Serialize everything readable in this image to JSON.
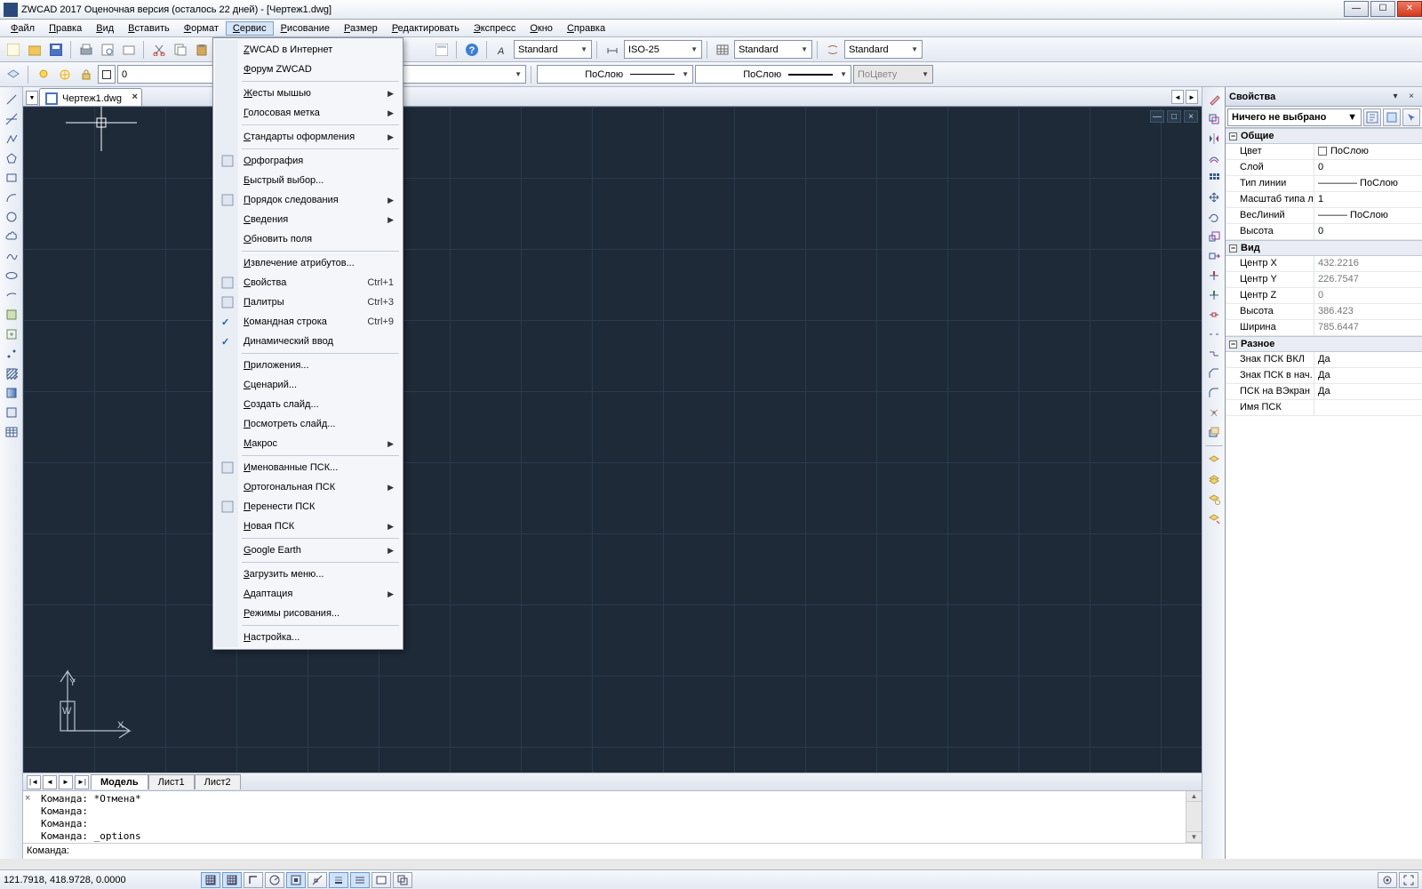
{
  "title": "ZWCAD 2017 Оценочная версия (осталось 22 дней) - [Чертеж1.dwg]",
  "menubar": [
    "Файл",
    "Правка",
    "Вид",
    "Вставить",
    "Формат",
    "Сервис",
    "Рисование",
    "Размер",
    "Редактировать",
    "Экспресс",
    "Окно",
    "Справка"
  ],
  "menubar_open_index": 5,
  "toolbar1": {
    "combo_text_style": "Standard",
    "combo_dim_style": "ISO-25",
    "combo_table_style": "Standard",
    "combo_mline_style": "Standard"
  },
  "toolbar2": {
    "layer_combo": "0",
    "color_combo": "ПоСлою",
    "ltype_combo": "ПоСлою",
    "lweight_combo": "ПоЦвету"
  },
  "doc_tab": "Чертеж1.dwg",
  "model_tabs": {
    "active": "Модель",
    "others": [
      "Лист1",
      "Лист2"
    ]
  },
  "command_history": [
    "Команда: *Отмена*",
    "Команда:",
    "Команда:",
    "Команда: _options"
  ],
  "command_prompt": "Команда:",
  "status_coords": "121.7918, 418.9728, 0.0000",
  "props": {
    "title": "Свойства",
    "selection": "Ничего не выбрано",
    "groups": [
      {
        "name": "Общие",
        "rows": [
          {
            "k": "Цвет",
            "v": "ПоСлою",
            "swatch": true
          },
          {
            "k": "Слой",
            "v": "0"
          },
          {
            "k": "Тип линии",
            "v": "———— ПоСлою"
          },
          {
            "k": "Масштаб типа л...",
            "v": "1"
          },
          {
            "k": "ВесЛиний",
            "v": "——— ПоСлою"
          },
          {
            "k": "Высота",
            "v": "0"
          }
        ]
      },
      {
        "name": "Вид",
        "rows": [
          {
            "k": "Центр X",
            "v": "432.2216",
            "ro": true
          },
          {
            "k": "Центр Y",
            "v": "226.7547",
            "ro": true
          },
          {
            "k": "Центр Z",
            "v": "0",
            "ro": true
          },
          {
            "k": "Высота",
            "v": "386.423",
            "ro": true
          },
          {
            "k": "Ширина",
            "v": "785.6447",
            "ro": true
          }
        ]
      },
      {
        "name": "Разное",
        "rows": [
          {
            "k": "Знак ПСК ВКЛ",
            "v": "Да"
          },
          {
            "k": "Знак ПСК в нач. ...",
            "v": "Да"
          },
          {
            "k": "ПСК на ВЭкран",
            "v": "Да"
          },
          {
            "k": "Имя ПСК",
            "v": ""
          }
        ]
      }
    ]
  },
  "dropdown": [
    {
      "t": "item",
      "label": "ZWCAD в Интернет"
    },
    {
      "t": "item",
      "label": "Форум ZWCAD"
    },
    {
      "t": "sep"
    },
    {
      "t": "item",
      "label": "Жесты мышью",
      "sub": true
    },
    {
      "t": "item",
      "label": "Голосовая метка",
      "sub": true
    },
    {
      "t": "sep"
    },
    {
      "t": "item",
      "label": "Стандарты оформления",
      "sub": true
    },
    {
      "t": "sep"
    },
    {
      "t": "item",
      "label": "Орфография",
      "icon": "spell"
    },
    {
      "t": "item",
      "label": "Быстрый выбор..."
    },
    {
      "t": "item",
      "label": "Порядок следования",
      "sub": true,
      "icon": "order"
    },
    {
      "t": "item",
      "label": "Сведения",
      "sub": true
    },
    {
      "t": "item",
      "label": "Обновить поля"
    },
    {
      "t": "sep"
    },
    {
      "t": "item",
      "label": "Извлечение атрибутов..."
    },
    {
      "t": "item",
      "label": "Свойства",
      "shortcut": "Ctrl+1",
      "checked": true,
      "icon": "props"
    },
    {
      "t": "item",
      "label": "Палитры",
      "shortcut": "Ctrl+3",
      "icon": "pal"
    },
    {
      "t": "item",
      "label": "Командная строка",
      "shortcut": "Ctrl+9",
      "checked": true
    },
    {
      "t": "item",
      "label": "Динамический ввод",
      "checked": true
    },
    {
      "t": "sep"
    },
    {
      "t": "item",
      "label": "Приложения..."
    },
    {
      "t": "item",
      "label": "Сценарий..."
    },
    {
      "t": "item",
      "label": "Создать слайд..."
    },
    {
      "t": "item",
      "label": "Посмотреть слайд..."
    },
    {
      "t": "item",
      "label": "Макрос",
      "sub": true
    },
    {
      "t": "sep"
    },
    {
      "t": "item",
      "label": "Именованные ПСК...",
      "icon": "ucs"
    },
    {
      "t": "item",
      "label": "Ортогональная ПСК",
      "sub": true
    },
    {
      "t": "item",
      "label": "Перенести ПСК",
      "icon": "ucs2"
    },
    {
      "t": "item",
      "label": "Новая ПСК",
      "sub": true
    },
    {
      "t": "sep"
    },
    {
      "t": "item",
      "label": "Google Earth",
      "sub": true
    },
    {
      "t": "sep"
    },
    {
      "t": "item",
      "label": "Загрузить меню..."
    },
    {
      "t": "item",
      "label": "Адаптация",
      "sub": true
    },
    {
      "t": "item",
      "label": "Режимы рисования..."
    },
    {
      "t": "sep"
    },
    {
      "t": "item",
      "label": "Настройка..."
    }
  ],
  "icons": {
    "new": "#e7c46a",
    "open": "#e7b54a",
    "save": "#4a72c8",
    "print": "#7a8aa6",
    "cut": "#888",
    "copy": "#b88a3a",
    "paste": "#b88a3a",
    "undo": "#3a76c8",
    "redo": "#3a76c8",
    "help": "#2a6fd0"
  }
}
